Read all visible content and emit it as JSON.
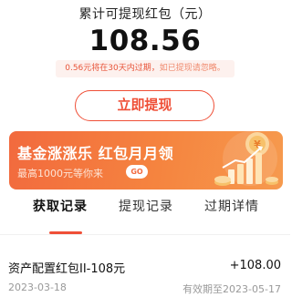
{
  "summary": {
    "label": "累计可提现红包（元）",
    "amount": "108.56",
    "notice_main": "0.56元将在30天内过期，",
    "notice_sub": "如已提现请忽略。"
  },
  "withdraw_button": "立即提现",
  "banner": {
    "title": "基金涨涨乐  红包月月领",
    "subtitle": "最高1000元等你来",
    "go_label": "GO"
  },
  "tabs": [
    "获取记录",
    "提现记录",
    "过期详情"
  ],
  "records": [
    {
      "name": "资产配置红包II-108元",
      "amount": "+108.00",
      "date": "2023-03-18",
      "expiry": "有效期至2023-05-17"
    }
  ],
  "colors": {
    "accent": "#ef4f37",
    "banner_start": "#f26a3e",
    "banner_end": "#f69a4e",
    "notice_bg": "#fdf1ee"
  }
}
